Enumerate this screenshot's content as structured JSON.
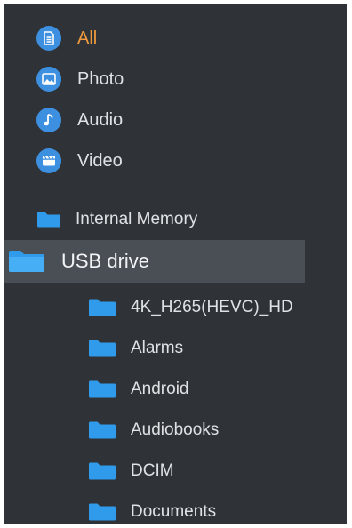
{
  "categories": [
    {
      "label": "All",
      "icon": "document-icon",
      "active": true
    },
    {
      "label": "Photo",
      "icon": "image-icon",
      "active": false
    },
    {
      "label": "Audio",
      "icon": "music-note-icon",
      "active": false
    },
    {
      "label": "Video",
      "icon": "video-icon",
      "active": false
    }
  ],
  "storage": {
    "internal_label": "Internal Memory",
    "usb_label": "USB drive",
    "usb_folders": [
      "4K_H265(HEVC)_HD",
      "Alarms",
      "Android",
      "Audiobooks",
      "DCIM",
      "Documents"
    ]
  },
  "colors": {
    "background": "#2f3338",
    "selected_row": "#4a4f55",
    "active_text": "#ef9a3c",
    "icon_blue": "#3d8fe0",
    "folder_blue": "#2f9bea",
    "text": "#dfe2e5"
  }
}
